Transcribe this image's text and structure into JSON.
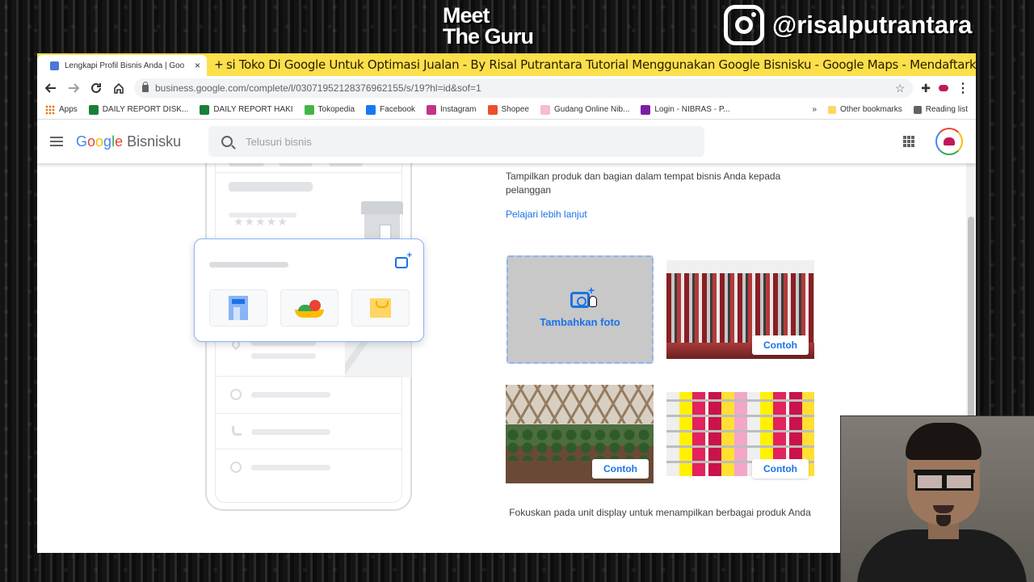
{
  "overlay": {
    "logo_line1": "Meet",
    "logo_line2": "The Guru",
    "instagram_handle": "@risalputrantara"
  },
  "browser": {
    "tab_title": "Lengkapi Profil Bisnis Anda | Goo",
    "tab_close": "×",
    "new_tab": "+",
    "marquee": "si Toko Di Google Untuk Optimasi Jualan - By Risal Putrantara  Tutorial Menggunakan Google Bisnisku - Google Maps - Mendaftarkan Lokasi",
    "url": "business.google.com/complete/l/03071952128376962155/s/19?hl=id&sof=1",
    "bookmarks": [
      {
        "label": "Apps",
        "color": "#e8710a"
      },
      {
        "label": "DAILY REPORT DISK...",
        "color": "#188038"
      },
      {
        "label": "DAILY REPORT HAKI",
        "color": "#188038"
      },
      {
        "label": "Tokopedia",
        "color": "#42b549"
      },
      {
        "label": "Facebook",
        "color": "#1877f2"
      },
      {
        "label": "Instagram",
        "color": "#c13584"
      },
      {
        "label": "Shopee",
        "color": "#ee4d2d"
      },
      {
        "label": "Gudang Online Nib...",
        "color": "#f8bbd0"
      },
      {
        "label": "Login - NIBRAS - P...",
        "color": "#7b1fa2"
      }
    ],
    "bookmarks_more": "»",
    "other_bookmarks": "Other bookmarks",
    "reading_list": "Reading list"
  },
  "gmb": {
    "logo_google": "Google",
    "logo_product": "Bisnisku",
    "search_placeholder": "Telusuri bisnis"
  },
  "main": {
    "description": "Tampilkan produk dan bagian dalam tempat bisnis Anda kepada pelanggan",
    "learn_more": "Pelajari lebih lanjut",
    "add_photo": "Tambahkan foto",
    "example_label": "Contoh",
    "footer": "Fokuskan pada unit display untuk menampilkan berbagai produk Anda"
  },
  "phone_preview": {
    "stars": "★★★★★"
  }
}
